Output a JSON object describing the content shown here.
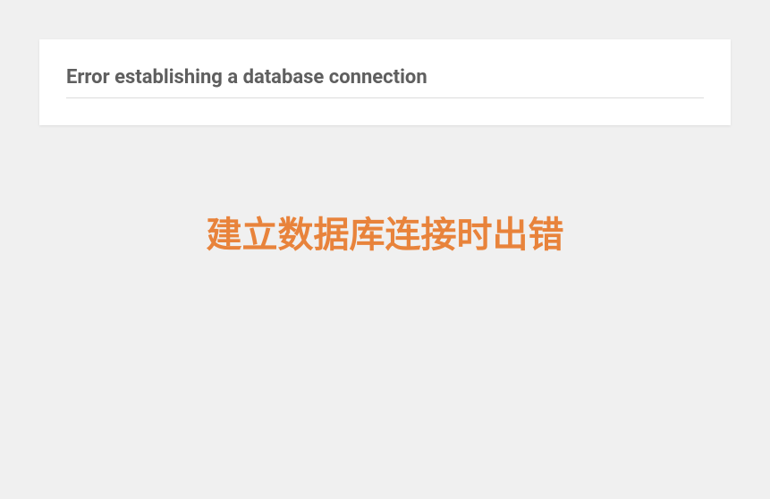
{
  "error": {
    "title_en": "Error establishing a database connection",
    "title_zh": "建立数据库连接时出错"
  }
}
